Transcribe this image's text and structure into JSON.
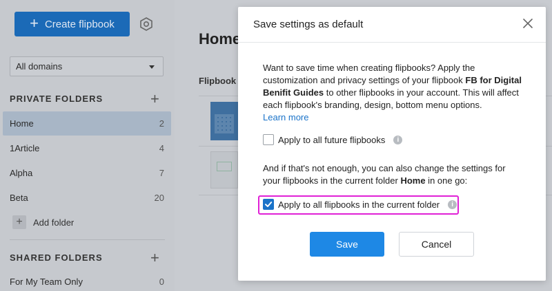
{
  "sidebar": {
    "create_label": "Create flipbook",
    "domain_value": "All domains",
    "private_heading": "PRIVATE FOLDERS",
    "private_folders": [
      {
        "name": "Home",
        "count": "2"
      },
      {
        "name": "1Article",
        "count": "4"
      },
      {
        "name": "Alpha",
        "count": "7"
      },
      {
        "name": "Beta",
        "count": "20"
      }
    ],
    "add_folder_label": "Add folder",
    "shared_heading": "SHARED FOLDERS",
    "shared_folders": [
      {
        "name": "For My Team Only",
        "count": "0"
      }
    ]
  },
  "main": {
    "title": "Home",
    "column_label": "Flipbook"
  },
  "modal": {
    "title": "Save settings as default",
    "intro_1": "Want to save time when creating flipbooks? Apply the customization and privacy settings of your flipbook ",
    "flipbook_name": "FB for Digital Benifit Guides",
    "intro_2": " to other flipbooks in your account. This will affect each flipbook's branding, design, bottom menu options.",
    "learn_more": "Learn more",
    "option_future": "Apply to all future flipbooks",
    "option_future_checked": false,
    "extra_1": "And if that's not enough, you can also change the settings for your flipbooks in the current folder ",
    "folder_name": "Home",
    "extra_2": " in one go:",
    "option_folder": "Apply to all flipbooks in the current folder",
    "option_folder_checked": true,
    "save_label": "Save",
    "cancel_label": "Cancel"
  },
  "colors": {
    "accent": "#1e88e5",
    "highlight": "#e020d6"
  }
}
